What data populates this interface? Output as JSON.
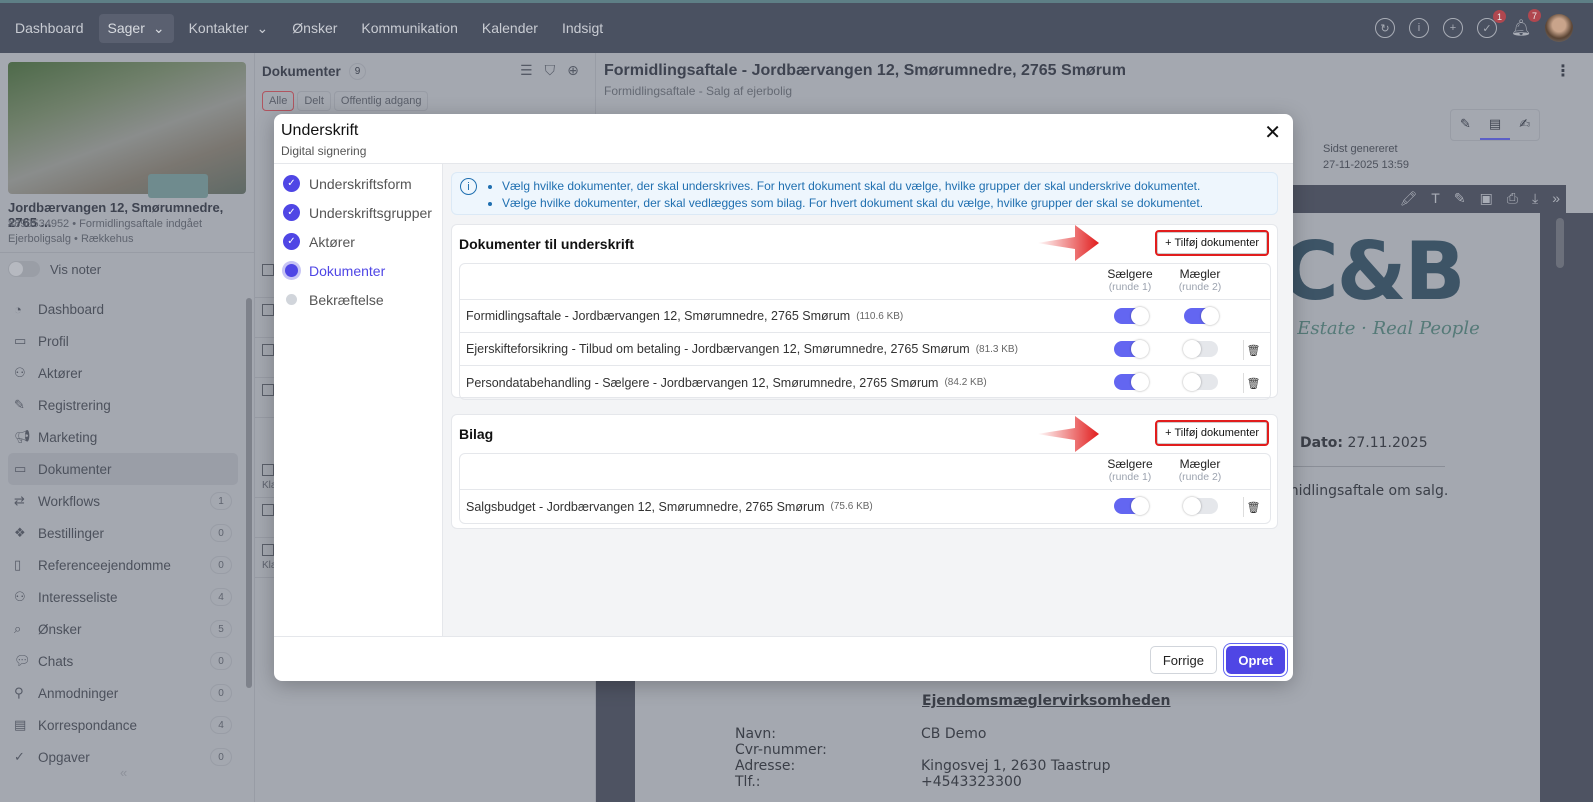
{
  "nav": {
    "items": [
      "Dashboard",
      "Sager",
      "Kontakter",
      "Ønsker",
      "Kommunikation",
      "Kalender",
      "Indsigt"
    ],
    "badges": {
      "tasks": "1",
      "notifications": "7"
    }
  },
  "case": {
    "address": "Jordbærvangen 12, Smørumnedre, 2765 ...",
    "line1": "#899534952 • Formidlingsaftale indgået",
    "line2": "Ejerboligsalg • Rækkehus",
    "notes_label": "Vis noter"
  },
  "sidebar": {
    "items": [
      {
        "label": "Dashboard",
        "icon": "gauge",
        "count": null
      },
      {
        "label": "Profil",
        "icon": "id-card",
        "count": null
      },
      {
        "label": "Aktører",
        "icon": "users",
        "count": null
      },
      {
        "label": "Registrering",
        "icon": "pencil",
        "count": null
      },
      {
        "label": "Marketing",
        "icon": "megaphone",
        "count": null
      },
      {
        "label": "Dokumenter",
        "icon": "folder",
        "count": null
      },
      {
        "label": "Workflows",
        "icon": "workflow",
        "count": "1"
      },
      {
        "label": "Bestillinger",
        "icon": "boxes",
        "count": "0"
      },
      {
        "label": "Referenceejendomme",
        "icon": "building",
        "count": "0"
      },
      {
        "label": "Interesseliste",
        "icon": "users",
        "count": "4"
      },
      {
        "label": "Ønsker",
        "icon": "search-pin",
        "count": "5"
      },
      {
        "label": "Chats",
        "icon": "chat",
        "count": "0"
      },
      {
        "label": "Anmodninger",
        "icon": "user-plus",
        "count": "0"
      },
      {
        "label": "Korrespondance",
        "icon": "archive",
        "count": "4"
      },
      {
        "label": "Opgaver",
        "icon": "check",
        "count": "0"
      }
    ]
  },
  "docs": {
    "title": "Dokumenter",
    "count": "9",
    "filters": [
      "Alle",
      "Delt",
      "Offentlig adgang"
    ],
    "row_note": "Kla"
  },
  "doc": {
    "title": "Formidlingsaftale - Jordbærvangen 12, Smørumnedre, 2765 Smørum",
    "subtitle": "Formidlingsaftale - Salg af ejerbolig",
    "generated_label": "Sidst genereret",
    "generated_value": "27-11-2025 13:59",
    "logo": "C&B",
    "slogan": "al Estate · Real People",
    "date_label": "Dato:",
    "date_value": "27.11.2025",
    "intro": "midlingsaftale om salg.",
    "section": "Ejendomsmæglervirksomheden",
    "fields": [
      {
        "k": "Navn:",
        "v": "CB Demo"
      },
      {
        "k": "Cvr-nummer:",
        "v": ""
      },
      {
        "k": "Adresse:",
        "v": "Kingosvej 1, 2630 Taastrup"
      },
      {
        "k": "Tlf.:",
        "v": "+4543323300"
      }
    ]
  },
  "modal": {
    "title": "Underskrift",
    "subtitle": "Digital signering",
    "steps": [
      {
        "label": "Underskriftsform",
        "state": "done"
      },
      {
        "label": "Underskriftsgrupper",
        "state": "done"
      },
      {
        "label": "Aktører",
        "state": "done"
      },
      {
        "label": "Dokumenter",
        "state": "current"
      },
      {
        "label": "Bekræftelse",
        "state": "todo"
      }
    ],
    "info": [
      "Vælg hvilke dokumenter, der skal underskrives. For hvert dokument skal du vælge, hvilke grupper der skal underskrive dokumentet.",
      "Vælge hvilke dokumenter, der skal vedlægges som bilag. For hvert dokument skal du vælge, hvilke grupper der skal se dokumentet."
    ],
    "add_label": "+ Tilføj dokumenter",
    "columns": [
      {
        "name": "Sælgere",
        "sub": "(runde 1)"
      },
      {
        "name": "Mægler",
        "sub": "(runde 2)"
      }
    ],
    "sign_section": {
      "title": "Dokumenter til underskrift",
      "rows": [
        {
          "name": "Formidlingsaftale - Jordbærvangen 12, Smørumnedre, 2765 Smørum",
          "size": "(110.6 KB)",
          "saelgere": true,
          "maegler": true,
          "deletable": false
        },
        {
          "name": "Ejerskifteforsikring - Tilbud om betaling - Jordbærvangen 12, Smørumnedre, 2765 Smørum",
          "size": "(81.3 KB)",
          "saelgere": true,
          "maegler": false,
          "deletable": true
        },
        {
          "name": "Persondatabehandling - Sælgere - Jordbærvangen 12, Smørumnedre, 2765 Smørum",
          "size": "(84.2 KB)",
          "saelgere": true,
          "maegler": false,
          "deletable": true
        }
      ]
    },
    "attach_section": {
      "title": "Bilag",
      "rows": [
        {
          "name": "Salgsbudget - Jordbærvangen 12, Smørumnedre, 2765 Smørum",
          "size": "(75.6 KB)",
          "saelgere": true,
          "maegler": false,
          "deletable": true
        }
      ]
    },
    "prev_label": "Forrige",
    "create_label": "Opret"
  },
  "colors": {
    "accent": "#4f46e5",
    "toggle_on": "#6366f1",
    "highlight": "#e11d1d",
    "info": "#1f6fb0"
  }
}
